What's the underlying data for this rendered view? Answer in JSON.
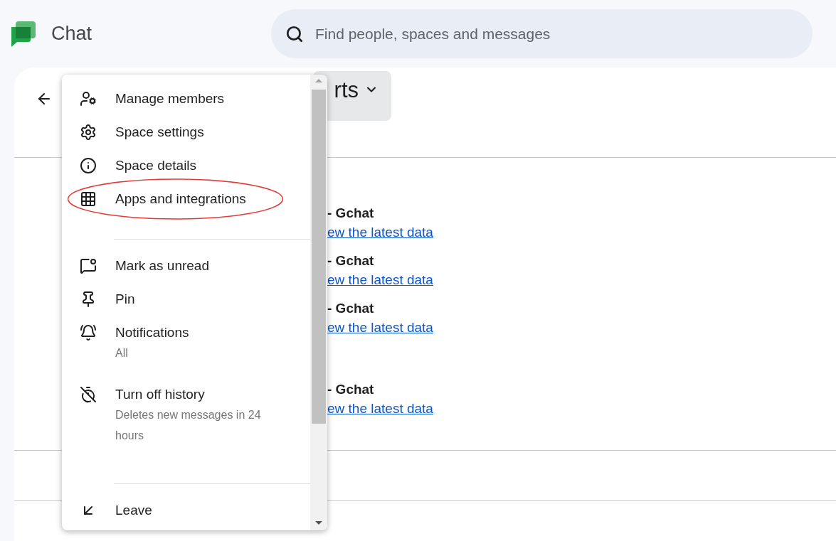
{
  "app": {
    "name": "Chat"
  },
  "search": {
    "placeholder": "Find people, spaces and messages"
  },
  "space": {
    "title": "rts"
  },
  "messages": [
    {
      "sender": "- Gchat",
      "link": "ew the latest data"
    },
    {
      "sender": "- Gchat",
      "link": "ew the latest data"
    },
    {
      "sender": "- Gchat",
      "link": "ew the latest data"
    },
    {
      "sender": "- Gchat",
      "link": "ew the latest data"
    }
  ],
  "menu": {
    "items": [
      {
        "kind": "item",
        "label": "Manage members",
        "circled": false
      },
      {
        "kind": "item",
        "label": "Space settings",
        "circled": false
      },
      {
        "kind": "item",
        "label": "Space details",
        "circled": false
      },
      {
        "kind": "item",
        "label": "Apps and integrations",
        "circled": true
      },
      {
        "kind": "divider"
      },
      {
        "kind": "item",
        "label": "Mark as unread",
        "circled": false
      },
      {
        "kind": "item",
        "label": "Pin",
        "circled": false
      },
      {
        "kind": "item",
        "label": "Notifications",
        "subtitle": "All",
        "circled": false
      },
      {
        "kind": "item",
        "label": "Turn off history",
        "subtitle": "Deletes new messages in 24 hours",
        "circled": false
      },
      {
        "kind": "divider"
      },
      {
        "kind": "item",
        "label": "Leave",
        "circled": false
      }
    ]
  }
}
